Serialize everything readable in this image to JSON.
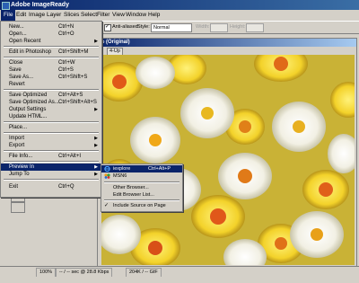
{
  "app": {
    "title": "Adobe ImageReady"
  },
  "menubar": {
    "items": [
      "File",
      "Edit",
      "Image",
      "Layer",
      "Slices",
      "Select",
      "Filter",
      "View",
      "Window",
      "Help"
    ]
  },
  "options": {
    "anti_aliased": "Anti-aliased",
    "style_label": "Style:",
    "style_value": "Normal",
    "width_label": "Width:",
    "height_label": "Height:"
  },
  "document": {
    "title": "% (Original)",
    "tabs": [
      "4-Up"
    ]
  },
  "statusbar": {
    "zoom": "100%",
    "download": "-- / -- sec @ 28.8 Kbps",
    "size": "204K / -- GIF"
  },
  "file_menu": {
    "items": [
      {
        "label": "New...",
        "shortcut": "Ctrl+N"
      },
      {
        "label": "Open...",
        "shortcut": "Ctrl+O"
      },
      {
        "label": "Open Recent",
        "shortcut": ""
      },
      {
        "label": "Edit in Photoshop",
        "shortcut": "Ctrl+Shift+M"
      },
      {
        "label": "Close",
        "shortcut": "Ctrl+W"
      },
      {
        "label": "Save",
        "shortcut": "Ctrl+S"
      },
      {
        "label": "Save As...",
        "shortcut": "Ctrl+Shift+S"
      },
      {
        "label": "Revert",
        "shortcut": ""
      },
      {
        "label": "Save Optimized",
        "shortcut": "Ctrl+Alt+S"
      },
      {
        "label": "Save Optimized As...",
        "shortcut": "Ctrl+Shift+Alt+S"
      },
      {
        "label": "Output Settings",
        "shortcut": ""
      },
      {
        "label": "Update HTML...",
        "shortcut": ""
      },
      {
        "label": "Place...",
        "shortcut": ""
      },
      {
        "label": "Import",
        "shortcut": ""
      },
      {
        "label": "Export",
        "shortcut": ""
      },
      {
        "label": "File Info...",
        "shortcut": "Ctrl+Alt+I"
      },
      {
        "label": "Preview In",
        "shortcut": ""
      },
      {
        "label": "Jump To",
        "shortcut": ""
      },
      {
        "label": "Exit",
        "shortcut": "Ctrl+Q"
      }
    ]
  },
  "preview_submenu": {
    "items": [
      {
        "label": "iexplore",
        "shortcut": "Ctrl+Alt+P"
      },
      {
        "label": "MSN6",
        "shortcut": ""
      },
      {
        "label": "Other Browser...",
        "shortcut": ""
      },
      {
        "label": "Edit Browser List...",
        "shortcut": ""
      },
      {
        "label": "Include Source on Page",
        "shortcut": ""
      }
    ]
  },
  "colors": {
    "menu_highlight": "#0a246a",
    "title_bar": "#0a246a",
    "chrome": "#d4d0c8"
  }
}
